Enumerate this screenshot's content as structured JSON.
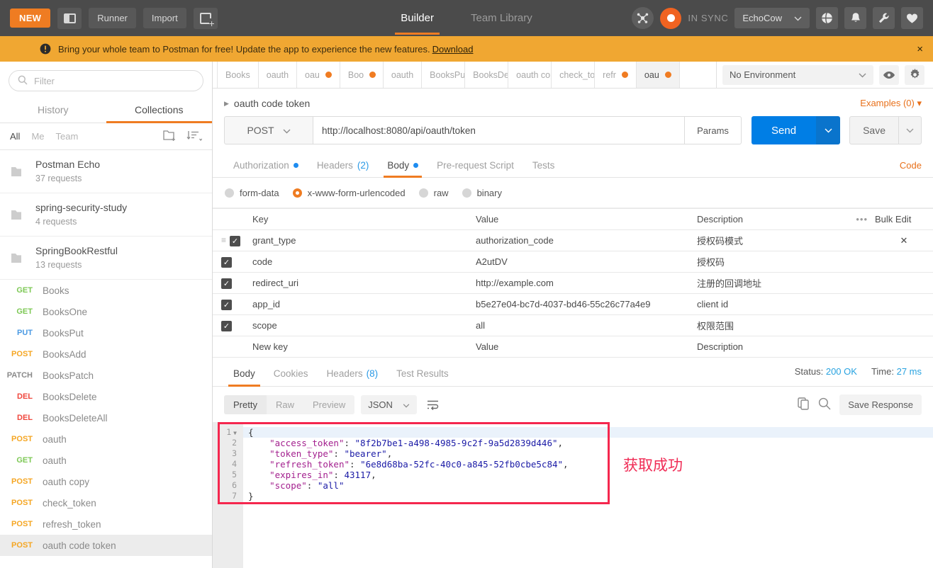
{
  "topbar": {
    "new_label": "NEW",
    "sidebar_toggle": "sidebar-toggle-icon",
    "runner_label": "Runner",
    "import_label": "Import",
    "new_tab": "new-tab-icon",
    "tabs": [
      {
        "label": "Builder",
        "active": true
      },
      {
        "label": "Team Library",
        "active": false
      }
    ],
    "interceptor_icon": "interceptor-icon",
    "sync_status": "IN SYNC",
    "user_name": "EchoCow",
    "icons": [
      "globe-icon",
      "bell-icon",
      "wrench-icon",
      "heart-icon"
    ],
    "accent_orange": "#ef7c22"
  },
  "banner": {
    "icon": "alert-icon",
    "text": "Bring your whole team to Postman for free! Update the app to experience the new features.",
    "link": "Download",
    "close": "×",
    "bg": "#f0a732"
  },
  "sidebar": {
    "filter_placeholder": "Filter",
    "search_icon": "search-icon",
    "tabs": [
      {
        "label": "History",
        "active": false
      },
      {
        "label": "Collections",
        "active": true
      }
    ],
    "scopes": [
      {
        "label": "All",
        "active": true
      },
      {
        "label": "Me",
        "active": false
      },
      {
        "label": "Team",
        "active": false
      }
    ],
    "new_folder_icon": "new-folder-icon",
    "sort_icon": "sort-icon",
    "collections": [
      {
        "name": "Postman Echo",
        "count": "37 requests"
      },
      {
        "name": "spring-security-study",
        "count": "4 requests"
      },
      {
        "name": "SpringBookRestful",
        "count": "13 requests"
      }
    ],
    "requests": [
      {
        "method": "GET",
        "name": "Books",
        "cls": "m-get",
        "selected": false
      },
      {
        "method": "GET",
        "name": "BooksOne",
        "cls": "m-get",
        "selected": false
      },
      {
        "method": "PUT",
        "name": "BooksPut",
        "cls": "m-put",
        "selected": false
      },
      {
        "method": "POST",
        "name": "BooksAdd",
        "cls": "m-post",
        "selected": false
      },
      {
        "method": "PATCH",
        "name": "BooksPatch",
        "cls": "m-patch",
        "selected": false
      },
      {
        "method": "DEL",
        "name": "BooksDelete",
        "cls": "m-del",
        "selected": false
      },
      {
        "method": "DEL",
        "name": "BooksDeleteAll",
        "cls": "m-del",
        "selected": false
      },
      {
        "method": "POST",
        "name": "oauth",
        "cls": "m-post",
        "selected": false
      },
      {
        "method": "GET",
        "name": "oauth",
        "cls": "m-get",
        "selected": false
      },
      {
        "method": "POST",
        "name": "oauth copy",
        "cls": "m-post",
        "selected": false
      },
      {
        "method": "POST",
        "name": "check_token",
        "cls": "m-post",
        "selected": false
      },
      {
        "method": "POST",
        "name": "refresh_token",
        "cls": "m-post",
        "selected": false
      },
      {
        "method": "POST",
        "name": "oauth code token",
        "cls": "m-post",
        "selected": true
      }
    ]
  },
  "tabstrip": [
    {
      "label": "Books",
      "dirty": false,
      "active": false
    },
    {
      "label": "oauth",
      "dirty": false,
      "active": false
    },
    {
      "label": "oau",
      "dirty": true,
      "active": false
    },
    {
      "label": "Boo",
      "dirty": true,
      "active": false
    },
    {
      "label": "oauth",
      "dirty": false,
      "active": false
    },
    {
      "label": "BooksPut",
      "dirty": false,
      "active": false
    },
    {
      "label": "BooksDe",
      "dirty": false,
      "active": false
    },
    {
      "label": "oauth cop",
      "dirty": false,
      "active": false
    },
    {
      "label": "check_tok",
      "dirty": false,
      "active": false
    },
    {
      "label": "refr",
      "dirty": true,
      "active": false
    },
    {
      "label": "oau",
      "dirty": true,
      "active": true
    }
  ],
  "environment": {
    "selected": "No Environment",
    "caret": "chevron-down-icon",
    "eye_icon": "eye-icon",
    "gear_icon": "gear-icon"
  },
  "request": {
    "title": "oauth code token",
    "examples": "Examples (0)",
    "method": "POST",
    "url": "http://localhost:8080/api/oauth/token",
    "params_label": "Params",
    "send_label": "Send",
    "save_label": "Save",
    "tabs": [
      {
        "label": "Authorization",
        "dot": true,
        "count": "",
        "active": false
      },
      {
        "label": "Headers",
        "dot": false,
        "count": "(2)",
        "active": false
      },
      {
        "label": "Body",
        "dot": true,
        "count": "",
        "active": true
      },
      {
        "label": "Pre-request Script",
        "dot": false,
        "count": "",
        "active": false
      },
      {
        "label": "Tests",
        "dot": false,
        "count": "",
        "active": false
      }
    ],
    "code_link": "Code",
    "body_types": [
      {
        "label": "form-data",
        "selected": false
      },
      {
        "label": "x-www-form-urlencoded",
        "selected": true
      },
      {
        "label": "raw",
        "selected": false
      },
      {
        "label": "binary",
        "selected": false
      }
    ],
    "table": {
      "headers": [
        "Key",
        "Value",
        "Description"
      ],
      "bulk_edit": "Bulk Edit",
      "more": "•••",
      "rows": [
        {
          "checked": true,
          "key": "grant_type",
          "value": "authorization_code",
          "desc": "授权码模式",
          "first": true
        },
        {
          "checked": true,
          "key": "code",
          "value": "A2utDV",
          "desc": "授权码",
          "first": false
        },
        {
          "checked": true,
          "key": "redirect_uri",
          "value": "http://example.com",
          "desc": "注册的回调地址",
          "first": false
        },
        {
          "checked": true,
          "key": "app_id",
          "value": "b5e27e04-bc7d-4037-bd46-55c26c77a4e9",
          "desc": "client id",
          "first": false
        },
        {
          "checked": true,
          "key": "scope",
          "value": "all",
          "desc": "权限范围",
          "first": false
        }
      ],
      "new_row": {
        "key": "New key",
        "value": "Value",
        "desc": "Description"
      }
    }
  },
  "response": {
    "tabs": [
      {
        "label": "Body",
        "count": "",
        "active": true
      },
      {
        "label": "Cookies",
        "count": "",
        "active": false
      },
      {
        "label": "Headers",
        "count": "(8)",
        "active": false
      },
      {
        "label": "Test Results",
        "count": "",
        "active": false
      }
    ],
    "status_label": "Status:",
    "status_value": "200 OK",
    "time_label": "Time:",
    "time_value": "27 ms",
    "view_modes": [
      {
        "label": "Pretty",
        "active": true
      },
      {
        "label": "Raw",
        "active": false
      },
      {
        "label": "Preview",
        "active": false
      }
    ],
    "format": "JSON",
    "wrap_icon": "word-wrap-icon",
    "copy_icon": "copy-icon",
    "search_icon": "search-icon",
    "save_response": "Save Response",
    "annotation": "获取成功",
    "annotation_color": "#f02b55",
    "highlight_color": "#f5274e",
    "json": {
      "access_token": "8f2b7be1-a498-4985-9c2f-9a5d2839d446",
      "token_type": "bearer",
      "refresh_token": "6e8d68ba-52fc-40c0-a845-52fb0cbe5c84",
      "expires_in": 43117,
      "scope": "all"
    },
    "lines": [
      {
        "n": "1",
        "fold": true,
        "parts": [
          {
            "t": "{",
            "c": "p"
          }
        ]
      },
      {
        "n": "2",
        "fold": false,
        "parts": [
          {
            "t": "    ",
            "c": "p"
          },
          {
            "t": "\"access_token\"",
            "c": "k"
          },
          {
            "t": ": ",
            "c": "p"
          },
          {
            "t": "\"8f2b7be1-a498-4985-9c2f-9a5d2839d446\"",
            "c": "s"
          },
          {
            "t": ",",
            "c": "p"
          }
        ]
      },
      {
        "n": "3",
        "fold": false,
        "parts": [
          {
            "t": "    ",
            "c": "p"
          },
          {
            "t": "\"token_type\"",
            "c": "k"
          },
          {
            "t": ": ",
            "c": "p"
          },
          {
            "t": "\"bearer\"",
            "c": "s"
          },
          {
            "t": ",",
            "c": "p"
          }
        ]
      },
      {
        "n": "4",
        "fold": false,
        "parts": [
          {
            "t": "    ",
            "c": "p"
          },
          {
            "t": "\"refresh_token\"",
            "c": "k"
          },
          {
            "t": ": ",
            "c": "p"
          },
          {
            "t": "\"6e8d68ba-52fc-40c0-a845-52fb0cbe5c84\"",
            "c": "s"
          },
          {
            "t": ",",
            "c": "p"
          }
        ]
      },
      {
        "n": "5",
        "fold": false,
        "parts": [
          {
            "t": "    ",
            "c": "p"
          },
          {
            "t": "\"expires_in\"",
            "c": "k"
          },
          {
            "t": ": ",
            "c": "p"
          },
          {
            "t": "43117",
            "c": "n"
          },
          {
            "t": ",",
            "c": "p"
          }
        ]
      },
      {
        "n": "6",
        "fold": false,
        "parts": [
          {
            "t": "    ",
            "c": "p"
          },
          {
            "t": "\"scope\"",
            "c": "k"
          },
          {
            "t": ": ",
            "c": "p"
          },
          {
            "t": "\"all\"",
            "c": "s"
          }
        ]
      },
      {
        "n": "7",
        "fold": false,
        "parts": [
          {
            "t": "}",
            "c": "p"
          }
        ]
      }
    ]
  }
}
